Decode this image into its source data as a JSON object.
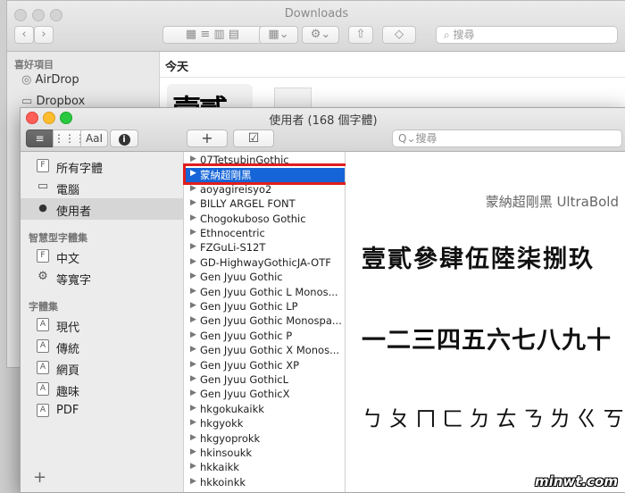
{
  "finder": {
    "title": "Downloads",
    "search_placeholder": "搜尋",
    "sidebar_header": "喜好項目",
    "sidebar_items": [
      "AirDrop",
      "Dropbox"
    ],
    "main_header": "今天",
    "thumb_text": "壹貳"
  },
  "fontbook": {
    "title": "使用者 (168 個字體)",
    "toolbar": {
      "view_list": "≡",
      "view_grid": "⋮⋮⋮",
      "view_sample": "AaI",
      "info": "i",
      "add": "+",
      "validate": "☑",
      "search_placeholder": "Q⌄搜尋"
    },
    "sidebar": {
      "items": [
        {
          "label": "所有字體",
          "icon": "F"
        },
        {
          "label": "電腦",
          "icon": "▭"
        },
        {
          "label": "使用者",
          "icon": "●"
        }
      ],
      "smart_header": "智慧型字體集",
      "smart_items": [
        {
          "label": "中文",
          "icon": "F"
        },
        {
          "label": "等寬字",
          "icon": "⚙"
        }
      ],
      "collections_header": "字體集",
      "collections": [
        {
          "label": "現代",
          "icon": "A"
        },
        {
          "label": "傳統",
          "icon": "A"
        },
        {
          "label": "網頁",
          "icon": "A"
        },
        {
          "label": "趣味",
          "icon": "A"
        },
        {
          "label": "PDF",
          "icon": "A"
        }
      ],
      "add_label": "+"
    },
    "fonts": [
      "07TetsubinGothic",
      "蒙納超剛黑",
      "aoyagireisyo2",
      "BILLY ARGEL FONT",
      "Chogokuboso Gothic",
      "Ethnocentric",
      "FZGuLi-S12T",
      "GD-HighwayGothicJA-OTF",
      "Gen Jyuu Gothic",
      "Gen Jyuu Gothic L Monos...",
      "Gen Jyuu Gothic LP",
      "Gen Jyuu Gothic Monospa...",
      "Gen Jyuu Gothic P",
      "Gen Jyuu Gothic X Monos...",
      "Gen Jyuu Gothic XP",
      "Gen Jyuu GothicL",
      "Gen Jyuu GothicX",
      "hkgokukaikk",
      "hkgyokk",
      "hkgyoprokk",
      "hkinsoukk",
      "hkkaikk",
      "hkkoinkk"
    ],
    "selected_font": "蒙納超剛黑",
    "preview": {
      "caption": "蒙納超剛黑 UltraBold",
      "line1": "壹貳參肆伍陸柒捌玖",
      "line2": "一二三四五六七八九十",
      "line3": "ㄅㄆㄇㄈㄉㄊㄋㄌㄍㄎ"
    }
  },
  "watermark": "minwt.com",
  "colors": {
    "selection": "#1565d8",
    "highlight_box": "#e01e1e",
    "close": "#ff5f57",
    "minimize": "#febc2e",
    "zoom": "#28c840"
  }
}
